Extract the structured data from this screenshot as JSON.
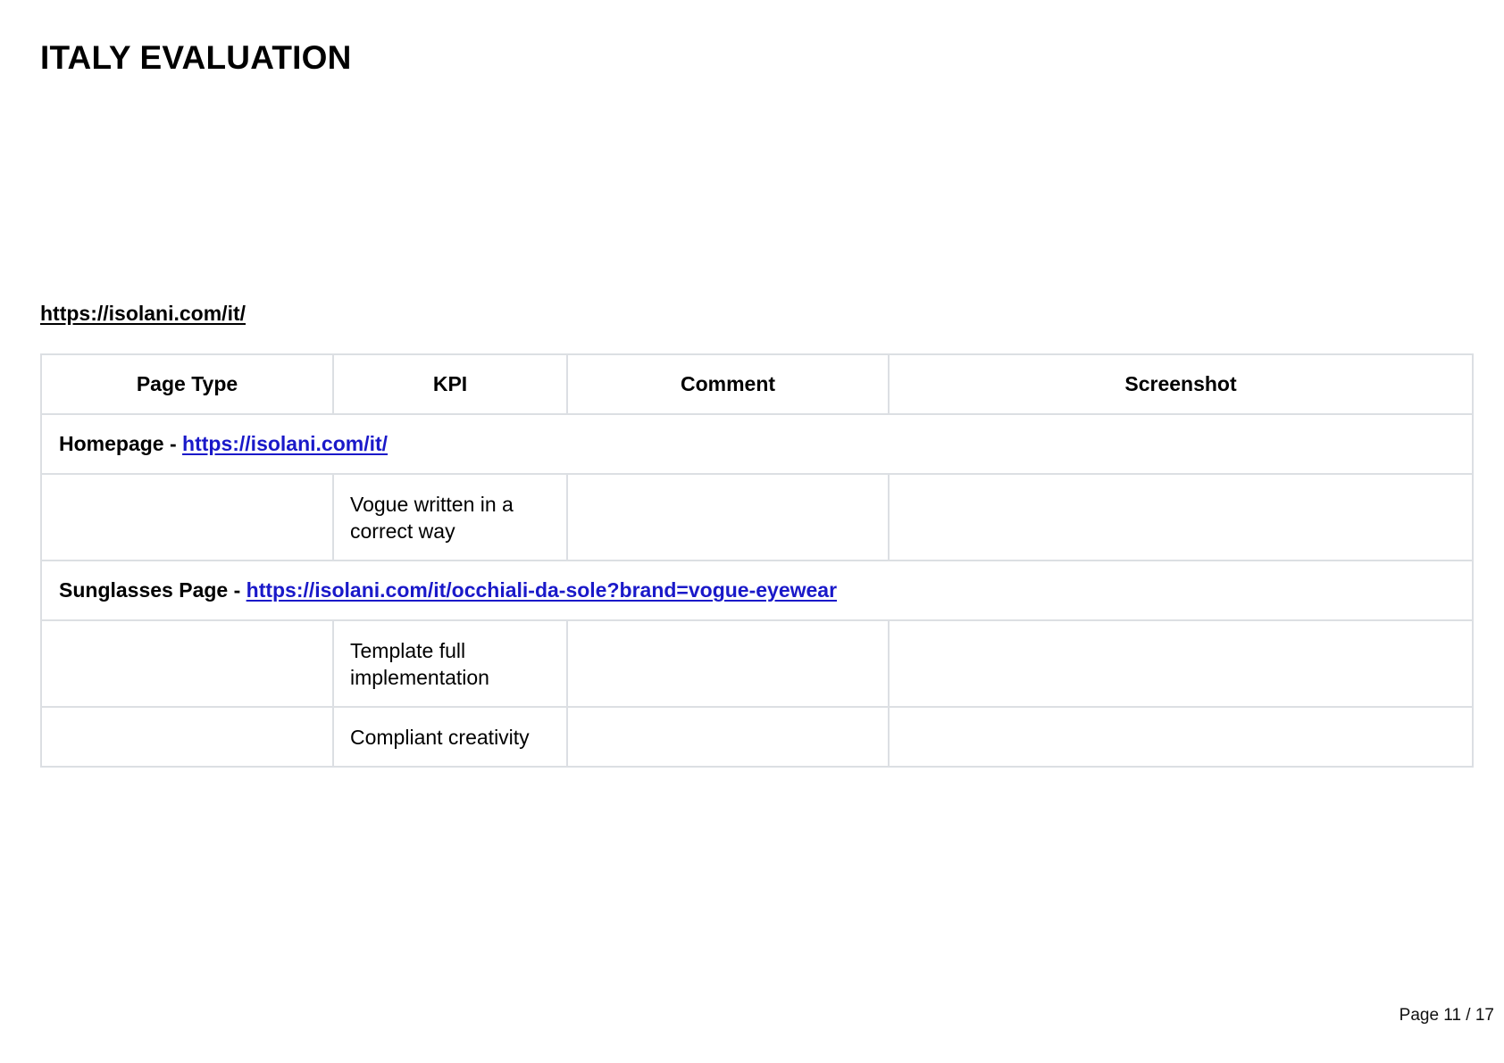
{
  "page_title": "ITALY EVALUATION",
  "section_url": "https://isolani.com/it/",
  "table": {
    "headers": {
      "page_type": "Page Type",
      "kpi": "KPI",
      "comment": "Comment",
      "screenshot": "Screenshot"
    },
    "groups": [
      {
        "label": "Homepage - ",
        "link": "https://isolani.com/it/",
        "rows": [
          {
            "kpi": "Vogue written in a correct way",
            "comment": "",
            "screenshot": ""
          }
        ]
      },
      {
        "label": "Sunglasses Page - ",
        "link": "https://isolani.com/it/occhiali-da-sole?brand=vogue-eyewear",
        "rows": [
          {
            "kpi": "Template full implementation",
            "comment": "",
            "screenshot": ""
          },
          {
            "kpi": "Compliant creativity",
            "comment": "",
            "screenshot": ""
          }
        ]
      }
    ]
  },
  "footer": {
    "page_label": "Page 11 / 17"
  },
  "colors": {
    "link": "#1a19c9",
    "table_border": "#dcdfe3"
  }
}
